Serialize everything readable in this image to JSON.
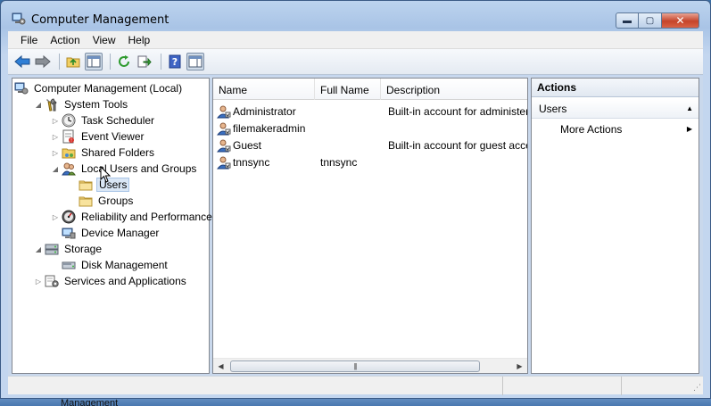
{
  "window": {
    "title": "Computer Management"
  },
  "window_buttons": {
    "minimize": "▬",
    "maximize": "▢",
    "close": "✕"
  },
  "menu": [
    "File",
    "Action",
    "View",
    "Help"
  ],
  "toolbar": [
    "back-arrow-icon",
    "forward-arrow-icon",
    "up-folder-icon",
    "show-hide-tree-icon",
    "refresh-icon",
    "export-list-icon",
    "help-icon",
    "show-hide-action-pane-icon"
  ],
  "tree": [
    {
      "label": "Computer Management (Local)",
      "icon": "computer-management-icon",
      "level": 0,
      "arrow": ""
    },
    {
      "label": "System Tools",
      "icon": "system-tools-icon",
      "level": 1,
      "arrow": "◢"
    },
    {
      "label": "Task Scheduler",
      "icon": "clock-icon",
      "level": 2,
      "arrow": "▷"
    },
    {
      "label": "Event Viewer",
      "icon": "event-viewer-icon",
      "level": 2,
      "arrow": "▷"
    },
    {
      "label": "Shared Folders",
      "icon": "shared-folder-icon",
      "level": 2,
      "arrow": "▷"
    },
    {
      "label": "Local Users and Groups",
      "icon": "users-groups-icon",
      "level": 2,
      "arrow": "◢"
    },
    {
      "label": "Users",
      "icon": "folder-icon",
      "level": 3,
      "arrow": "",
      "selected": true
    },
    {
      "label": "Groups",
      "icon": "folder-icon",
      "level": 3,
      "arrow": ""
    },
    {
      "label": "Reliability and Performance",
      "icon": "performance-icon",
      "level": 2,
      "arrow": "▷"
    },
    {
      "label": "Device Manager",
      "icon": "device-manager-icon",
      "level": 2,
      "arrow": ""
    },
    {
      "label": "Storage",
      "icon": "storage-icon",
      "level": 1,
      "arrow": "◢"
    },
    {
      "label": "Disk Management",
      "icon": "disk-icon",
      "level": 2,
      "arrow": ""
    },
    {
      "label": "Services and Applications",
      "icon": "services-icon",
      "level": 1,
      "arrow": "▷"
    }
  ],
  "list": {
    "columns": [
      "Name",
      "Full Name",
      "Description"
    ],
    "rows": [
      {
        "name": "Administrator",
        "full_name": "",
        "description": "Built-in account for administering the computer/domain"
      },
      {
        "name": "filemakeradmin",
        "full_name": "",
        "description": ""
      },
      {
        "name": "Guest",
        "full_name": "",
        "description": "Built-in account for guest access to the computer/domain"
      },
      {
        "name": "tnnsync",
        "full_name": "tnnsync",
        "description": ""
      }
    ]
  },
  "actions": {
    "title": "Actions",
    "section": "Users",
    "items": [
      "More Actions"
    ]
  },
  "desktop_text": "Management",
  "colors": {
    "title_bar": "#bcd3ee",
    "close_button": "#c5442a",
    "selection": "#d9e6f5"
  }
}
